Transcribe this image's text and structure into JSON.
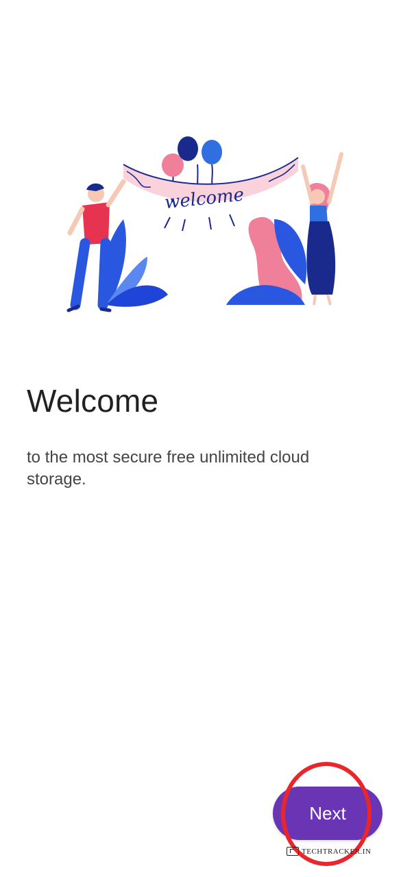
{
  "welcome_screen": {
    "illustration": {
      "name": "welcome-illustration",
      "banner_text": "welcome",
      "colors": {
        "blue": "#1e45d8",
        "navy": "#1a2a8c",
        "pink": "#f07f9a",
        "light_pink": "#f9d2dc",
        "red_shirt": "#e53350"
      }
    },
    "title": "Welcome",
    "subtitle": "to the most secure free unlimited cloud storage.",
    "next_button": {
      "label": "Next",
      "color": "#6a35b4"
    },
    "annotation": {
      "highlight_color": "#e8262b"
    },
    "watermark": {
      "text": "TECHTRACKER.IN"
    }
  }
}
